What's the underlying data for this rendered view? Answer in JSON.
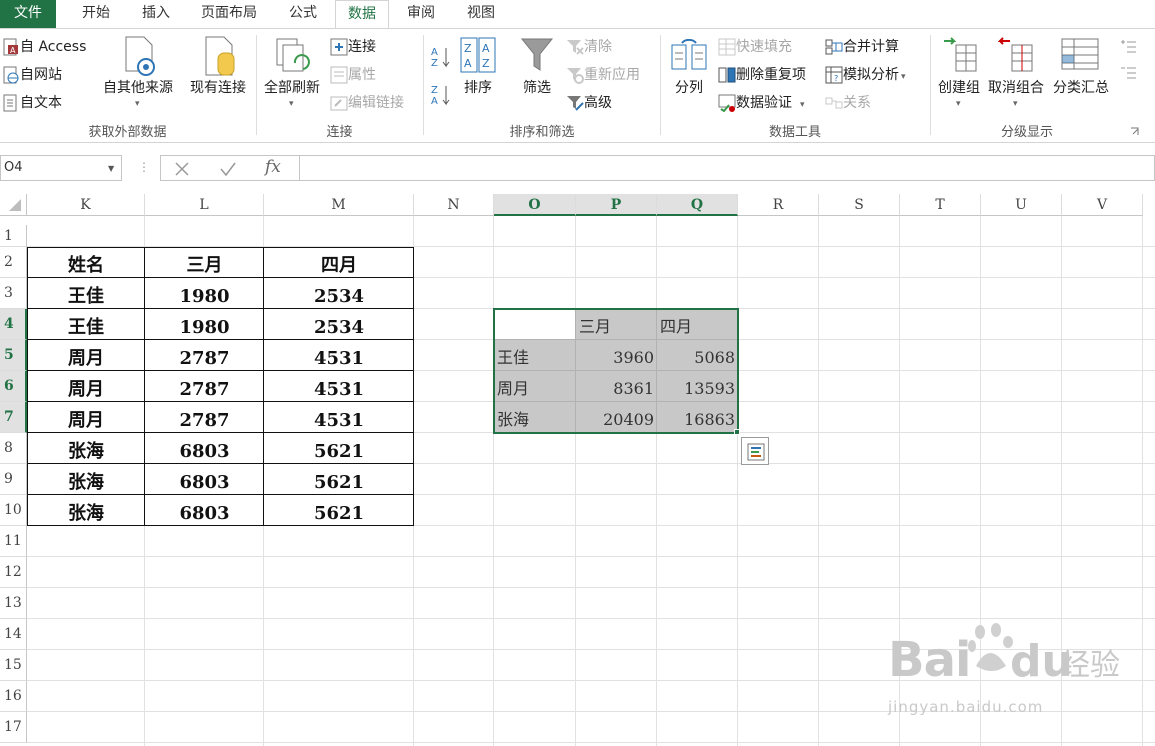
{
  "tabs": [
    "文件",
    "开始",
    "插入",
    "页面布局",
    "公式",
    "数据",
    "审阅",
    "视图"
  ],
  "active_tab": "数据",
  "ribbon": {
    "get_external": {
      "label": "获取外部数据",
      "from_access": "自 Access",
      "from_web": "自网站",
      "from_text": "自文本",
      "from_other": "自其他来源",
      "existing_conn": "现有连接"
    },
    "connections": {
      "label": "连接",
      "refresh_all": "全部刷新",
      "connections": "连接",
      "properties": "属性",
      "edit_links": "编辑链接"
    },
    "sort_filter": {
      "label": "排序和筛选",
      "sort": "排序",
      "filter": "筛选",
      "clear": "清除",
      "reapply": "重新应用",
      "advanced": "高级"
    },
    "data_tools": {
      "label": "数据工具",
      "text_to_columns": "分列",
      "flash_fill": "快速填充",
      "remove_duplicates": "删除重复项",
      "data_validation": "数据验证",
      "consolidate": "合并计算",
      "what_if": "模拟分析",
      "relationships": "关系"
    },
    "outline": {
      "label": "分级显示",
      "group": "创建组",
      "ungroup": "取消组合",
      "subtotal": "分类汇总"
    }
  },
  "formula_bar": {
    "name_box": "O4",
    "fx": "fx",
    "formula": ""
  },
  "columns": [
    "K",
    "L",
    "M",
    "N",
    "O",
    "P",
    "Q",
    "R",
    "S",
    "T",
    "U",
    "V"
  ],
  "rows": [
    "1",
    "2",
    "3",
    "4",
    "5",
    "6",
    "7",
    "8",
    "9",
    "10",
    "11",
    "12",
    "13",
    "14",
    "15",
    "16",
    "17"
  ],
  "table": {
    "headers": [
      "姓名",
      "三月",
      "四月"
    ],
    "rows": [
      [
        "王佳",
        "1980",
        "2534"
      ],
      [
        "王佳",
        "1980",
        "2534"
      ],
      [
        "周月",
        "2787",
        "4531"
      ],
      [
        "周月",
        "2787",
        "4531"
      ],
      [
        "周月",
        "2787",
        "4531"
      ],
      [
        "张海",
        "6803",
        "5621"
      ],
      [
        "张海",
        "6803",
        "5621"
      ],
      [
        "张海",
        "6803",
        "5621"
      ]
    ]
  },
  "consolidated": {
    "headers": [
      "",
      "三月",
      "四月"
    ],
    "rows": [
      [
        "王佳",
        "3960",
        "5068"
      ],
      [
        "周月",
        "8361",
        "13593"
      ],
      [
        "张海",
        "20409",
        "16863"
      ]
    ]
  },
  "watermark": {
    "brand": "Bai",
    "brand2": "du",
    "cn": "经验",
    "url": "jingyan.baidu.com"
  },
  "colors": {
    "accent": "#217346",
    "pivot_bg": "#c8c8c8"
  }
}
